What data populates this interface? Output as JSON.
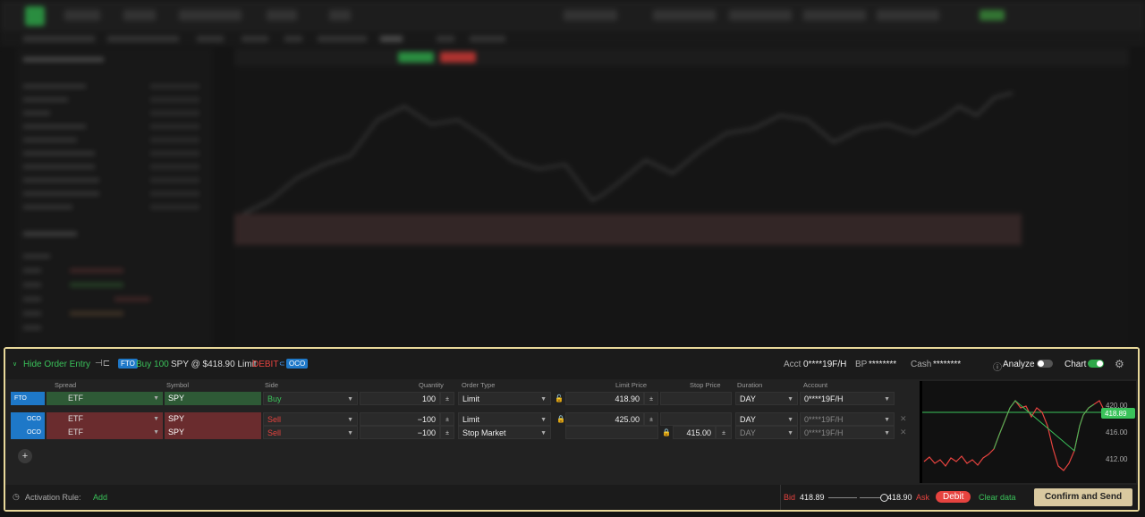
{
  "order_entry": {
    "hide_label": "Hide Order Entry",
    "summary": {
      "badge": "FTO",
      "action": "Buy 100",
      "desc": "SPY @ $418.90 Limit",
      "debit": "DEBIT",
      "oco_badge": "OCO"
    },
    "acct_label": "Acct",
    "acct_value": "0****19F/H",
    "bp_label": "BP",
    "bp_value": "********",
    "cash_label": "Cash",
    "cash_value": "********",
    "analyze_label": "Analyze",
    "chart_label": "Chart",
    "columns": [
      "Spread",
      "Symbol",
      "Side",
      "Quantity",
      "Order Type",
      "Limit Price",
      "Stop Price",
      "Duration",
      "Account"
    ],
    "rows": [
      {
        "badge": "FTO",
        "spread": "ETF",
        "symbol": "SPY",
        "side": "Buy",
        "qty": "100",
        "type": "Limit",
        "limit": "418.90",
        "stop": "",
        "duration": "DAY",
        "account": "0****19F/H"
      },
      {
        "badge": "OCO",
        "spread": "ETF",
        "symbol": "SPY",
        "side": "Sell",
        "qty": "−100",
        "type": "Limit",
        "limit": "425.00",
        "stop": "",
        "duration": "DAY",
        "account": "0****19F/H"
      },
      {
        "badge": "OCO",
        "spread": "ETF",
        "symbol": "SPY",
        "side": "Sell",
        "qty": "−100",
        "type": "Stop Market",
        "limit": "",
        "stop": "415.00",
        "duration": "DAY",
        "account": "0****19F/H"
      }
    ],
    "mini_chart": {
      "labels": [
        "420.00",
        "418.89",
        "416.00",
        "412.00"
      ]
    },
    "footer": {
      "activation_label": "Activation Rule:",
      "add_label": "Add",
      "bid_label": "Bid",
      "bid_value": "418.89",
      "ask_value": "418.90",
      "ask_label": "Ask",
      "debit_btn": "Debit",
      "clear_label": "Clear data",
      "confirm_label": "Confirm and Send"
    }
  },
  "colors": {
    "green": "#3ac25a",
    "red": "#e6433f",
    "accent": "#e8d89a"
  }
}
